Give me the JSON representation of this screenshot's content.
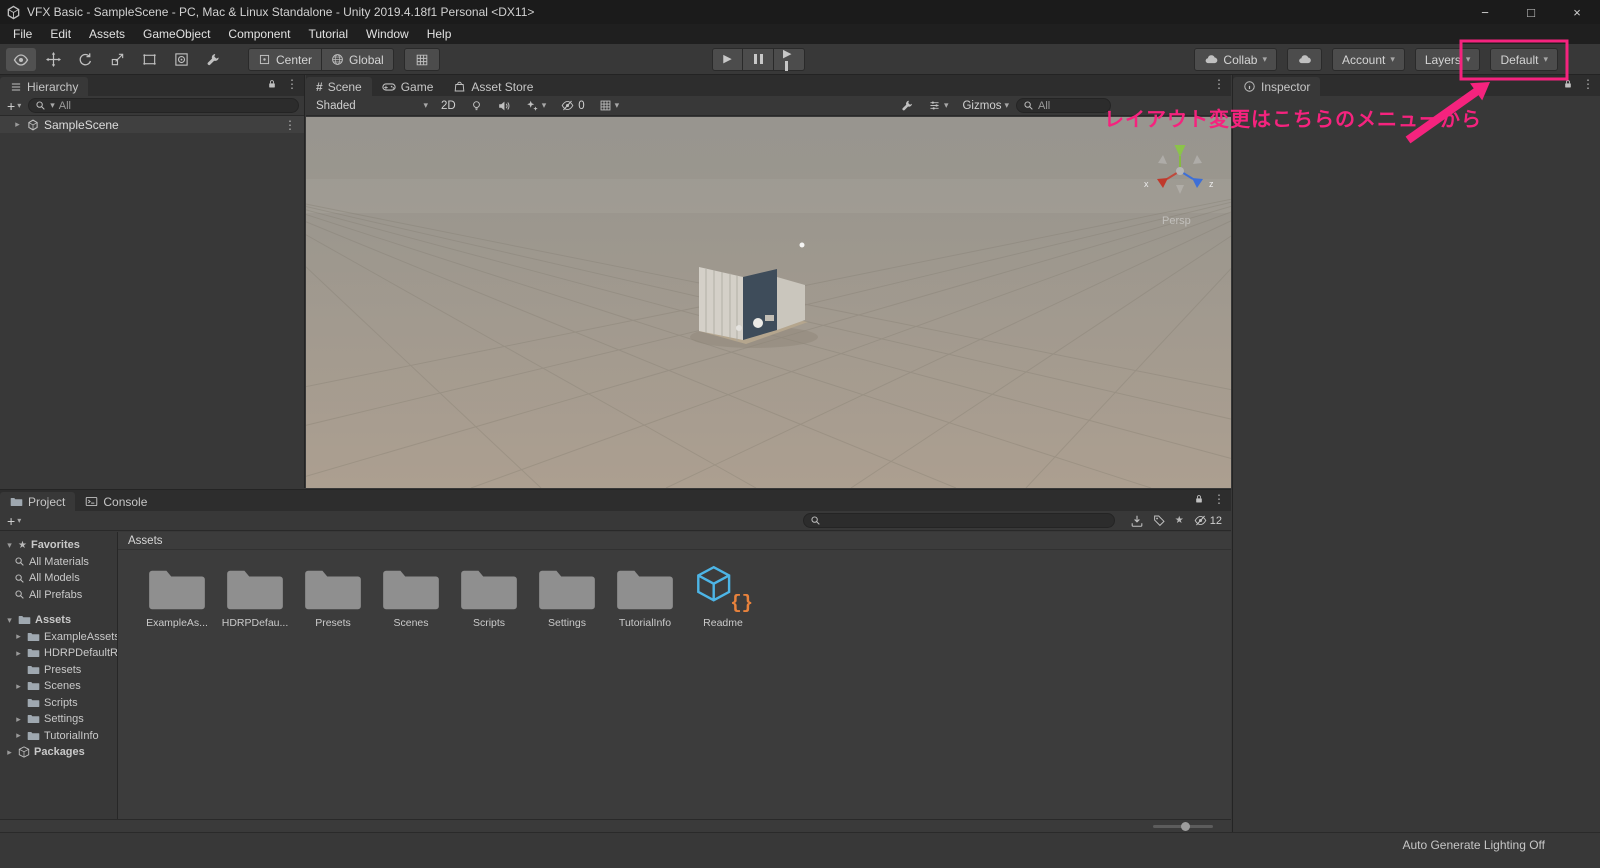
{
  "window": {
    "title": "VFX Basic - SampleScene - PC, Mac & Linux Standalone - Unity 2019.4.18f1 Personal <DX11>"
  },
  "icons": {
    "caret_down": "▾",
    "caret_right": "▸",
    "star": "★",
    "dots": "⋮",
    "plus": "+",
    "play": "▶",
    "hash": "#",
    "minimize": "−",
    "maximize": "□",
    "close": "×"
  },
  "menubar": {
    "items": [
      "File",
      "Edit",
      "Assets",
      "GameObject",
      "Component",
      "Tutorial",
      "Window",
      "Help"
    ]
  },
  "toolbar": {
    "center": "Center",
    "global": "Global",
    "collab": "Collab",
    "account": "Account",
    "layers": "Layers",
    "layout": "Default"
  },
  "annotation": {
    "text": "レイアウト変更はこちらのメニューから",
    "color": "#f5237e"
  },
  "hierarchy": {
    "tab": "Hierarchy",
    "search": "All",
    "scene_item": "SampleScene"
  },
  "scene_view": {
    "tabs": {
      "scene": "Scene",
      "game": "Game",
      "asset_store": "Asset Store"
    },
    "shading": "Shaded",
    "mode_2d": "2D",
    "hidden_count": "0",
    "gizmos": "Gizmos",
    "search": "All",
    "camera_label": "Persp",
    "axes": {
      "x": "x",
      "z": "z"
    }
  },
  "inspector": {
    "tab": "Inspector"
  },
  "project": {
    "tab_project": "Project",
    "tab_console": "Console",
    "hidden_count": "12",
    "favorites": {
      "label": "Favorites",
      "items": [
        "All Materials",
        "All Models",
        "All Prefabs"
      ]
    },
    "tree": {
      "root": "Assets",
      "children": [
        "ExampleAssets",
        "HDRPDefaultResources",
        "Presets",
        "Scenes",
        "Scripts",
        "Settings",
        "TutorialInfo"
      ],
      "packages": "Packages"
    },
    "breadcrumb": "Assets",
    "items": [
      {
        "label": "ExampleAs...",
        "type": "folder"
      },
      {
        "label": "HDRPDefau...",
        "type": "folder"
      },
      {
        "label": "Presets",
        "type": "folder"
      },
      {
        "label": "Scenes",
        "type": "folder"
      },
      {
        "label": "Scripts",
        "type": "folder"
      },
      {
        "label": "Settings",
        "type": "folder"
      },
      {
        "label": "TutorialInfo",
        "type": "folder"
      },
      {
        "label": "Readme",
        "type": "readme"
      }
    ]
  },
  "statusbar": {
    "message": "Auto Generate Lighting Off"
  },
  "colors": {
    "accent_pink": "#f5237e",
    "panel": "#383838",
    "panel_dark": "#2d2d2d",
    "readme_cube": "#4db5e6",
    "readme_braces": "#e8823c"
  }
}
